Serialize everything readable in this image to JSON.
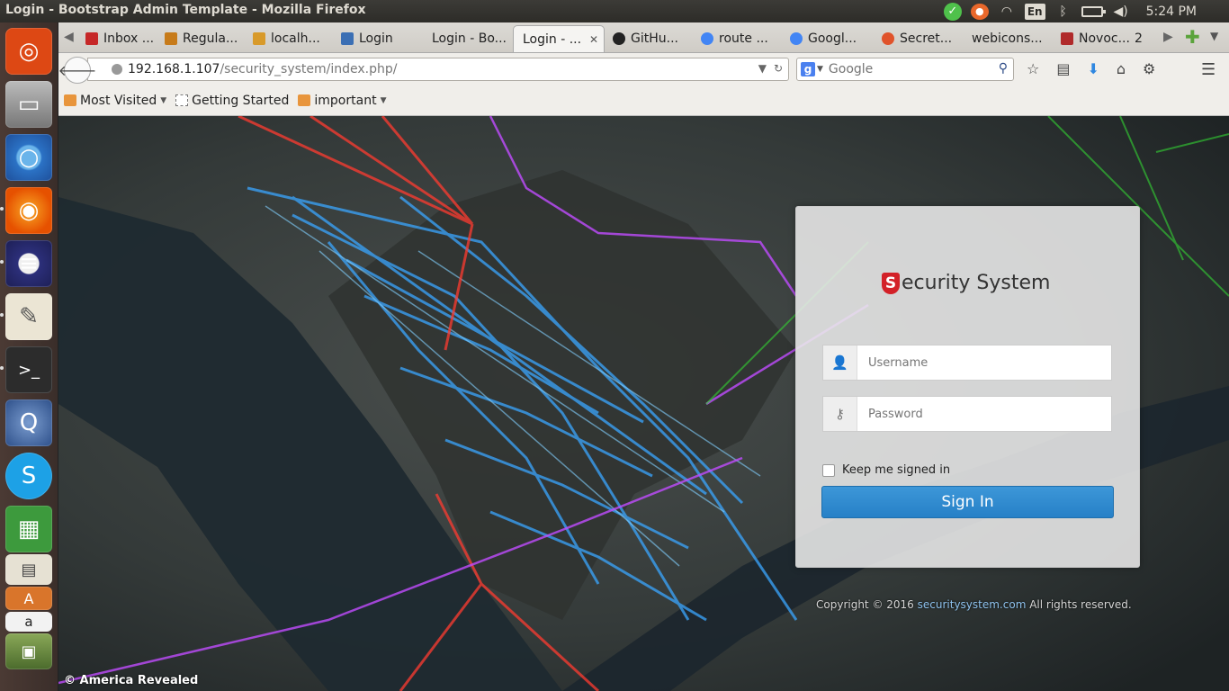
{
  "top_panel": {
    "window_title": "Login - Bootstrap Admin Template - Mozilla Firefox",
    "keyboard_layout": "En",
    "clock": "5:24 PM"
  },
  "launcher": {
    "items": [
      "ubuntu-dash-icon",
      "files-icon",
      "chromium-icon",
      "firefox-icon",
      "eclipse-icon",
      "text-editor-icon",
      "terminal-icon",
      "quassel-icon",
      "skype-icon",
      "spreadsheet-icon",
      "impress-icon",
      "software-center-icon",
      "amazon-icon",
      "image-viewer-icon"
    ]
  },
  "tabs": [
    {
      "label": "Inbox ...",
      "fav": "#c62828"
    },
    {
      "label": "Regula...",
      "fav": "#c77b1a"
    },
    {
      "label": "localh...",
      "fav": "#d89a2a"
    },
    {
      "label": "Login",
      "fav": "#3b6fb4"
    },
    {
      "label": "Login - Bo...",
      "fav": ""
    },
    {
      "label": "Login - ...",
      "fav": ""
    },
    {
      "label": "GitHu...",
      "fav": "#222222"
    },
    {
      "label": "route ...",
      "fav": "#4285f4"
    },
    {
      "label": "Googl...",
      "fav": "#4285f4"
    },
    {
      "label": "Secret...",
      "fav": "#e0532b"
    },
    {
      "label": "webicons...",
      "fav": ""
    },
    {
      "label": "Novoc...",
      "fav": "#b02a2a"
    }
  ],
  "tab_overflow": "2",
  "nav": {
    "url_host": "192.168.1.107",
    "url_path": "/security_system/index.php/",
    "search_placeholder": "Google"
  },
  "bookmarks": {
    "most_visited": "Most Visited",
    "getting_started": "Getting Started",
    "important": "important"
  },
  "page": {
    "watermark": "© America Revealed",
    "brand": "ecurity System",
    "brand_initial": "S",
    "username_placeholder": "Username",
    "password_placeholder": "Password",
    "remember_label": "Keep me signed in",
    "signin_label": "Sign In",
    "copyright_prefix": "Copyright © 2016",
    "copyright_link": "securitysystem.com",
    "copyright_suffix": "All rights reserved."
  },
  "colors": {
    "accent": "#2680c7",
    "brand_red": "#d32128"
  }
}
